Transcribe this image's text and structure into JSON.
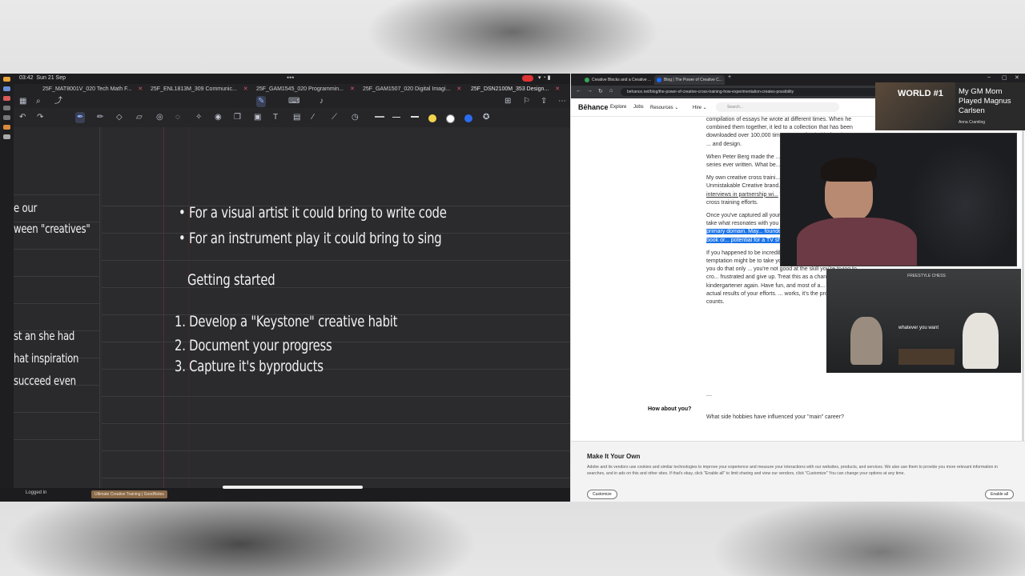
{
  "left": {
    "status": {
      "time": "03:42",
      "date": "Sun 21 Sep",
      "dots": "•••"
    },
    "tabs": [
      {
        "label": "25F_MAT8001V_020 Tech Math F..."
      },
      {
        "label": "25F_ENL1813M_309 Communic..."
      },
      {
        "label": "25F_GAM1545_020 Programmin..."
      },
      {
        "label": "25F_GAM1507_020 Digital Imagi..."
      },
      {
        "label": "25F_DSN2100M_353 Design..."
      }
    ],
    "thumb_lines": [
      "e our",
      "ween \"creatives\"",
      "st an she had",
      "hat inspiration",
      "succeed even"
    ],
    "notes": {
      "bullet1": "• For a visual artist it could bring to write code",
      "bullet2": "• For an instrument play it could bring to sing",
      "heading": "Getting started",
      "step1": "1. Develop a \"Keystone\" creative habit",
      "step2": "2. Document your progress",
      "step3": "3. Capture it's byproducts"
    },
    "footer": {
      "logged": "Logged in",
      "tag": "Ultimate Creative Training | GoodNotes"
    }
  },
  "right": {
    "browser_tabs": [
      {
        "label": "Creative Blocks and a Creative ..."
      },
      {
        "label": "Blog | The Power of Creative C..."
      }
    ],
    "address": "behance.net/blog/the-power-of-creative-cross-training-how-experimentation-creates-possibility",
    "nav": {
      "logo": "Bēhance",
      "explore": "Explore",
      "jobs": "Jobs",
      "resources": "Resources ⌄",
      "hire": "Hire ⌄",
      "search": "Search..."
    },
    "article": {
      "p1": "compilation of essays he wrote at different times. When he combined them together, it led to a collection that has been downloaded over 100,000 times ... was funded in four hours. It ... and design.",
      "p2": "When Peter Berg made the ... foundation for what would ... series ever written. What be... five season TV series.",
      "p3a": "My own creative cross traini... resulted in a significant visu... Unmistakable Creative brand... also resulted in the producti...",
      "p3link": "interviews in partnership wi...",
      "p3b": "Those are just a few of our ... cross training efforts.",
      "p4a": "Once you've captured all your byproducts rev... created. Then take what resonates with you a... you've learned into your ",
      "p4hl": "primary domain. May... founders you'll see the potential for a book or... potential for a TV show in something that star...",
      "p5": "If you happened to be incredibly skilled at one... your natural temptation might be to take your... training very seriously. When you do that only ... you're not good at the skill you're trying to cro... frustrated and give up. Treat this as a chance t... kindergartener again. Have fun, and most of a... much about the actual results of your efforts. ... works, it's the process that counts.",
      "dash": "—",
      "how": "How about you?",
      "question": "What side hobbies have influenced your \"main\" career?"
    },
    "cookie": {
      "title": "Make It Your Own",
      "desc": "Adobe and its vendors use cookies and similar technologies to improve your experience and measure your interactions with our websites, products, and services. We also use them to provide you more relevant information in searches, and in ads on this and other sites. If that's okay, click \"Enable all\" to limit sharing and view our vendors, click \"Customize\" You can change your options at any time.",
      "customize": "Customize",
      "enable": "Enable all"
    }
  },
  "overlays": {
    "promo": {
      "world": "WORLD #1",
      "line1": "My GM Mom",
      "line2": "Played Magnus",
      "line3": "Carlsen",
      "small": "Anna Cramling"
    },
    "chess": {
      "logo": "FREESTYLE CHESS",
      "caption": "whatever you want"
    }
  }
}
